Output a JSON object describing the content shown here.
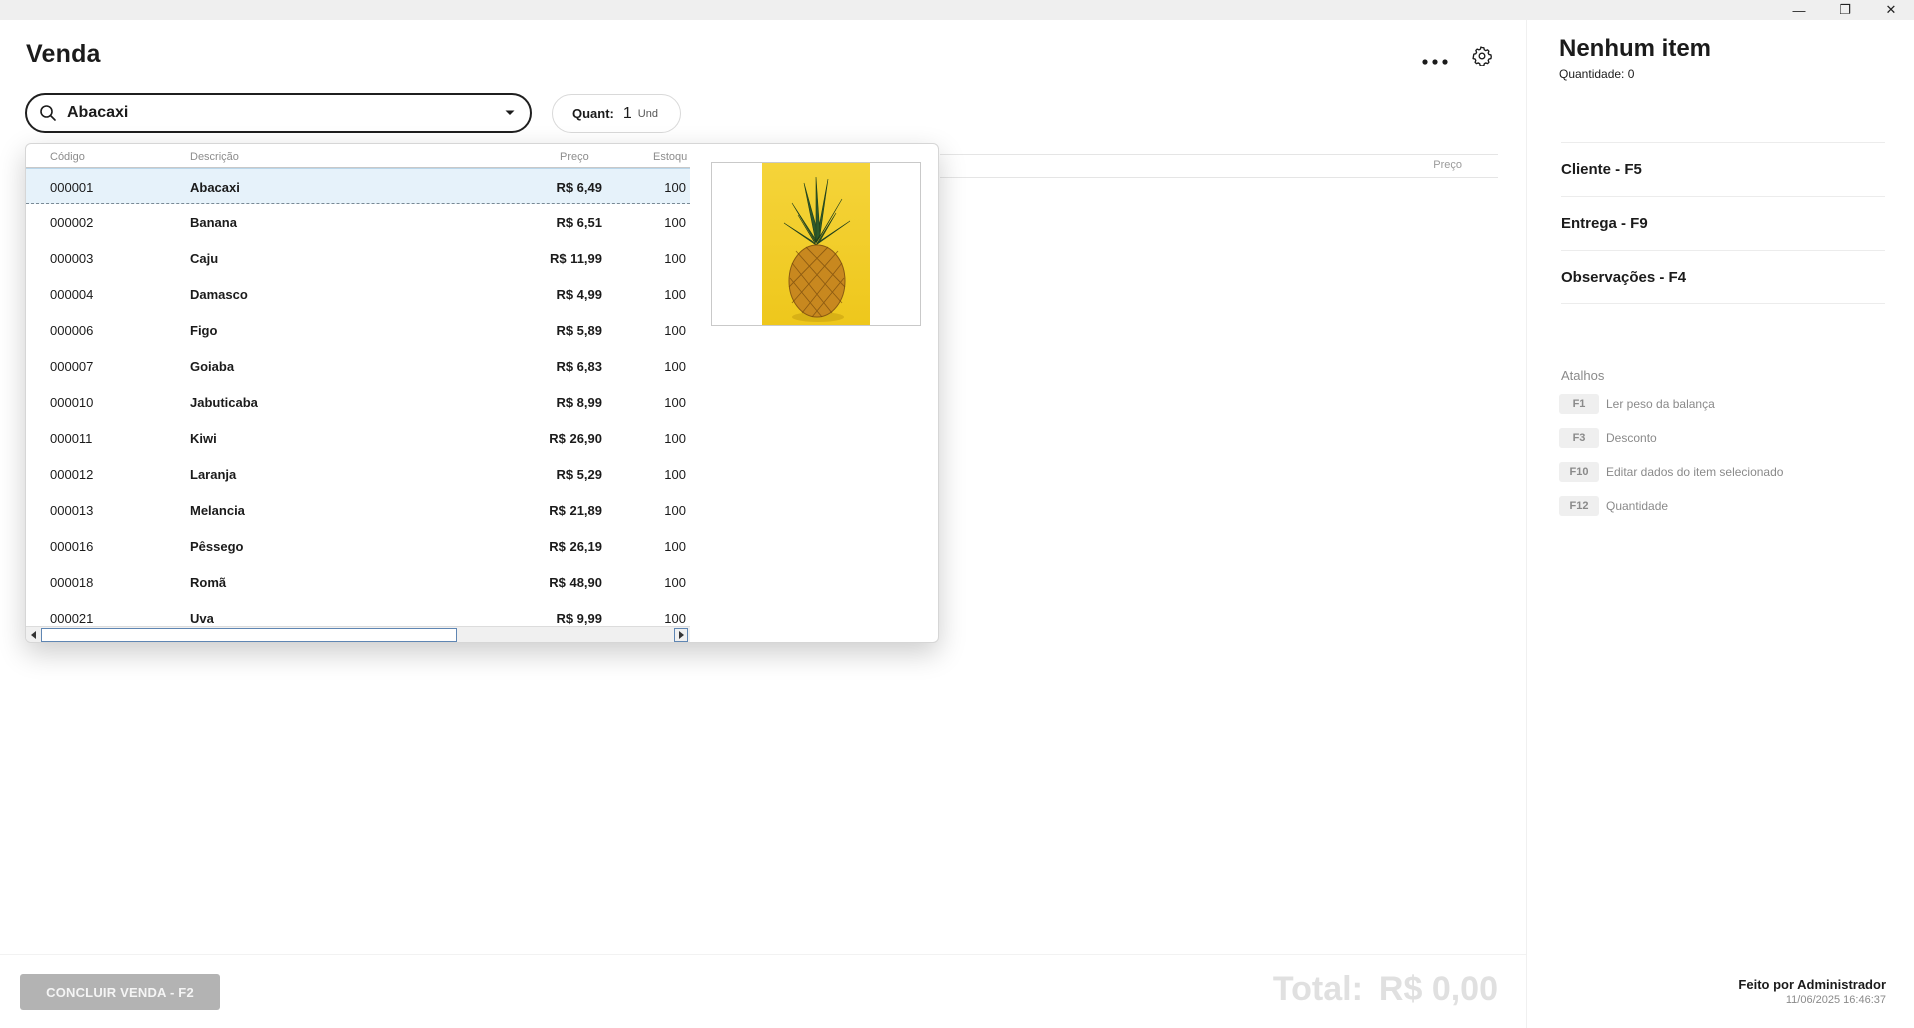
{
  "window": {
    "minimize_glyph": "—",
    "maximize_glyph": "❐",
    "close_glyph": "✕"
  },
  "header": {
    "title": "Venda"
  },
  "search": {
    "value": "Abacaxi"
  },
  "quantity": {
    "label": "Quant:",
    "value": "1",
    "unit": "Und"
  },
  "cart": {
    "price_header": "Preço"
  },
  "product_grid": {
    "columns": {
      "code": "Código",
      "description": "Descrição",
      "price": "Preço",
      "stock": "Estoqu"
    },
    "rows": [
      {
        "code": "000001",
        "description": "Abacaxi",
        "price": "R$ 6,49",
        "stock": "100"
      },
      {
        "code": "000002",
        "description": "Banana",
        "price": "R$ 6,51",
        "stock": "100"
      },
      {
        "code": "000003",
        "description": "Caju",
        "price": "R$ 11,99",
        "stock": "100"
      },
      {
        "code": "000004",
        "description": "Damasco",
        "price": "R$ 4,99",
        "stock": "100"
      },
      {
        "code": "000006",
        "description": "Figo",
        "price": "R$ 5,89",
        "stock": "100"
      },
      {
        "code": "000007",
        "description": "Goiaba",
        "price": "R$ 6,83",
        "stock": "100"
      },
      {
        "code": "000010",
        "description": "Jabuticaba",
        "price": "R$ 8,99",
        "stock": "100"
      },
      {
        "code": "000011",
        "description": "Kiwi",
        "price": "R$ 26,90",
        "stock": "100"
      },
      {
        "code": "000012",
        "description": "Laranja",
        "price": "R$ 5,29",
        "stock": "100"
      },
      {
        "code": "000013",
        "description": "Melancia",
        "price": "R$ 21,89",
        "stock": "100"
      },
      {
        "code": "000016",
        "description": "Pêssego",
        "price": "R$ 26,19",
        "stock": "100"
      },
      {
        "code": "000018",
        "description": "Romã",
        "price": "R$ 48,90",
        "stock": "100"
      },
      {
        "code": "000021",
        "description": "Uva",
        "price": "R$ 9,99",
        "stock": "100"
      }
    ]
  },
  "footer": {
    "finish_label": "CONCLUIR VENDA - F2",
    "total_label": "Total:",
    "total_value": "R$ 0,00"
  },
  "summary": {
    "title": "Nenhum item",
    "quantity_text": "Quantidade: 0"
  },
  "sections": {
    "client": "Cliente - F5",
    "delivery": "Entrega - F9",
    "notes": "Observações - F4"
  },
  "shortcuts": {
    "title": "Atalhos",
    "items": [
      {
        "key": "F1",
        "label": "Ler peso da balança"
      },
      {
        "key": "F3",
        "label": "Desconto"
      },
      {
        "key": "F10",
        "label": "Editar dados do item selecionado"
      },
      {
        "key": "F12",
        "label": "Quantidade"
      }
    ]
  },
  "made_by": {
    "text": "Feito por Administrador",
    "datetime": "11/06/2025 16:46:37"
  },
  "colors": {
    "accent": "#1f1f1f",
    "selection": "#e6f2fa",
    "muted": "#8a8a8a",
    "button_disabled": "#b3b3b3",
    "image_bg": "#f2cd2a"
  }
}
